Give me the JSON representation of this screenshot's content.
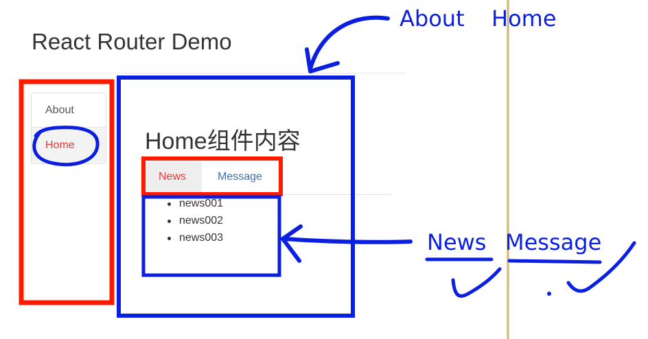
{
  "app": {
    "title": "React Router Demo"
  },
  "nav": {
    "about_label": "About",
    "home_label": "Home"
  },
  "content": {
    "title": "Home组件内容",
    "tabs": [
      {
        "label": "News"
      },
      {
        "label": "Message"
      }
    ],
    "news_items": [
      "news001",
      "news002",
      "news003"
    ]
  },
  "annotations": {
    "route_labels": [
      "About",
      "Home"
    ],
    "subroute_labels": [
      "News",
      "Message"
    ]
  },
  "colors": {
    "annotation_blue": "#0a1fe0",
    "annotation_red": "#ff1a00",
    "active_link": "#e53935",
    "link": "#3a6fb0"
  }
}
